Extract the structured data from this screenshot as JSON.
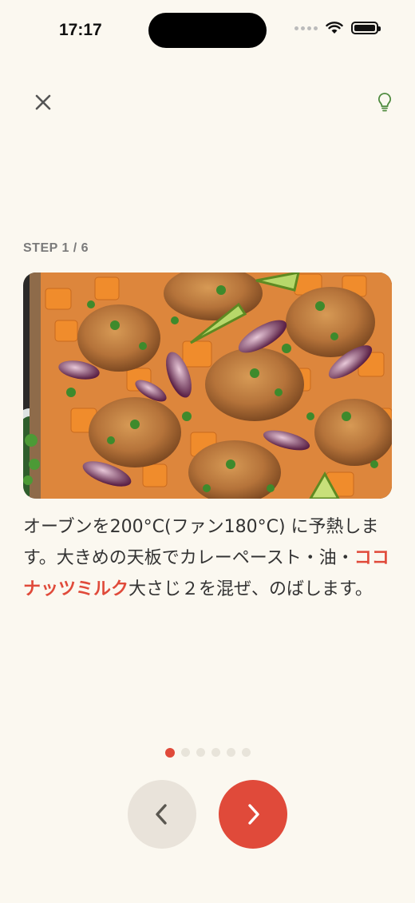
{
  "status_bar": {
    "time": "17:17"
  },
  "header": {
    "close_icon": "close-icon",
    "tip_icon": "lightbulb-icon"
  },
  "step": {
    "label": "STEP 1 / 6",
    "current": 1,
    "total": 6
  },
  "image": {
    "icon": "recipe-photo-chicken-sweet-potato-sheet-pan"
  },
  "instruction": {
    "before": "オーブンを200°C(ファン180°C) に予熱します。大きめの天板でカレーペースト・油・",
    "highlight": "ココナッツミルク",
    "after": "大さじ２を混ぜ、のばします。"
  },
  "colors": {
    "background": "#FBF8F0",
    "accent": "#E04A3A",
    "secondary_button": "#E9E3DA",
    "tip_icon": "#4E8A3E"
  },
  "navigation": {
    "prev_icon": "chevron-left-icon",
    "next_icon": "chevron-right-icon"
  }
}
